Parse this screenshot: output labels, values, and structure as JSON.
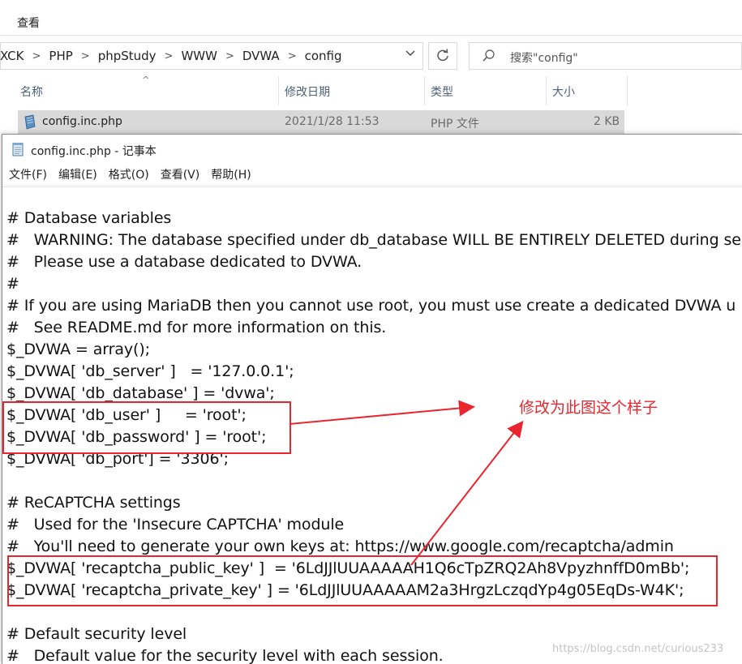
{
  "explorer": {
    "ribbon_tab": "查看",
    "breadcrumbs": [
      "XCK",
      "PHP",
      "phpStudy",
      "WWW",
      "DVWA",
      "config"
    ],
    "search_placeholder": "搜索\"config\"",
    "columns": {
      "name": "名称",
      "modified": "修改日期",
      "type": "类型",
      "size": "大小"
    },
    "file": {
      "name": "config.inc.php",
      "modified": "2021/1/28 11:53",
      "type": "PHP 文件",
      "size": "2 KB"
    }
  },
  "notepad": {
    "title": "config.inc.php - 记事本",
    "menu": [
      "文件(F)",
      "编辑(E)",
      "格式(O)",
      "查看(V)",
      "帮助(H)"
    ],
    "lines": [
      "# Database variables",
      "#   WARNING: The database specified under db_database WILL BE ENTIRELY DELETED during se",
      "#   Please use a database dedicated to DVWA.",
      "#",
      "# If you are using MariaDB then you cannot use root, you must use create a dedicated DVWA u",
      "#   See README.md for more information on this.",
      "$_DVWA = array();",
      "$_DVWA[ 'db_server' ]   = '127.0.0.1';",
      "$_DVWA[ 'db_database' ] = 'dvwa';",
      "$_DVWA[ 'db_user' ]     = 'root';",
      "$_DVWA[ 'db_password' ] = 'root';",
      "$_DVWA[ 'db_port'] = '3306';",
      "",
      "# ReCAPTCHA settings",
      "#   Used for the 'Insecure CAPTCHA' module",
      "#   You'll need to generate your own keys at: https://www.google.com/recaptcha/admin",
      "$_DVWA[ 'recaptcha_public_key' ]  = '6LdJJlUUAAAAAH1Q6cTpZRQ2Ah8VpyzhnffD0mBb';",
      "$_DVWA[ 'recaptcha_private_key' ] = '6LdJJlUUAAAAAM2a3HrgzLczqdYp4g05EqDs-W4K';",
      "",
      "# Default security level",
      "#   Default value for the security level with each session."
    ]
  },
  "annotation": {
    "text": "修改为此图这个样子",
    "color": "#e8262f"
  },
  "watermark": "https://blog.csdn.net/curious233"
}
